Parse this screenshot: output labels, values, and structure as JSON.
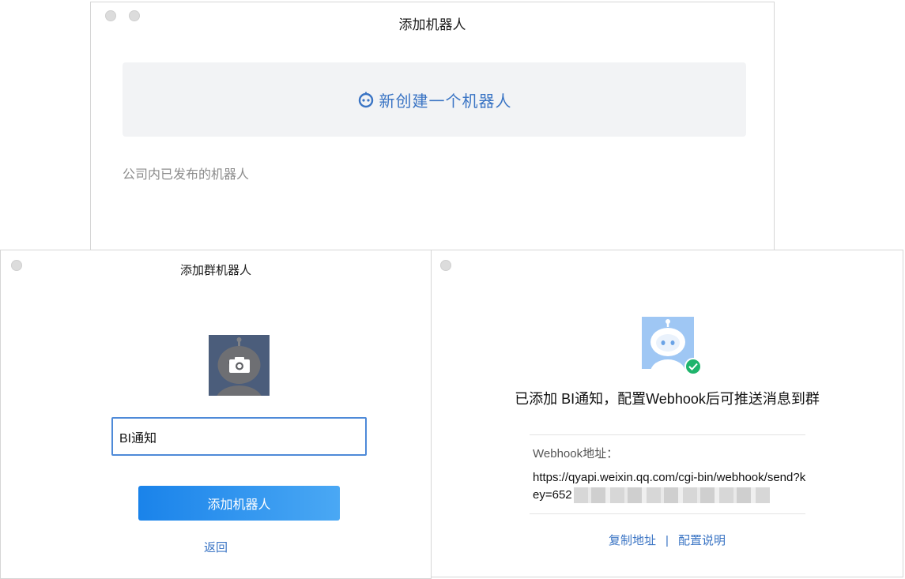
{
  "window_add_robot": {
    "title": "添加机器人",
    "create_label": "新创建一个机器人",
    "published_label": "公司内已发布的机器人"
  },
  "window_add_group_robot": {
    "title": "添加群机器人",
    "name_input_value": "BI通知",
    "add_button_label": "添加机器人",
    "back_label": "返回"
  },
  "window_robot_added": {
    "message": "已添加 BI通知，配置Webhook后可推送消息到群",
    "webhook_label": "Webhook地址：",
    "webhook_url_visible": "https://qyapi.weixin.qq.com/cgi-bin/webhook/send?key=652",
    "copy_label": "复制地址",
    "separator": "|",
    "help_label": "配置说明"
  },
  "colors": {
    "accent": "#3a74c4",
    "button_gradient_start": "#1a83ea",
    "button_gradient_end": "#4aa8f4",
    "success": "#1fb46c",
    "card_bg": "#f2f3f5"
  },
  "icons": {
    "create": "robot-icon",
    "avatar_upload": "camera-icon",
    "success": "check-icon"
  }
}
